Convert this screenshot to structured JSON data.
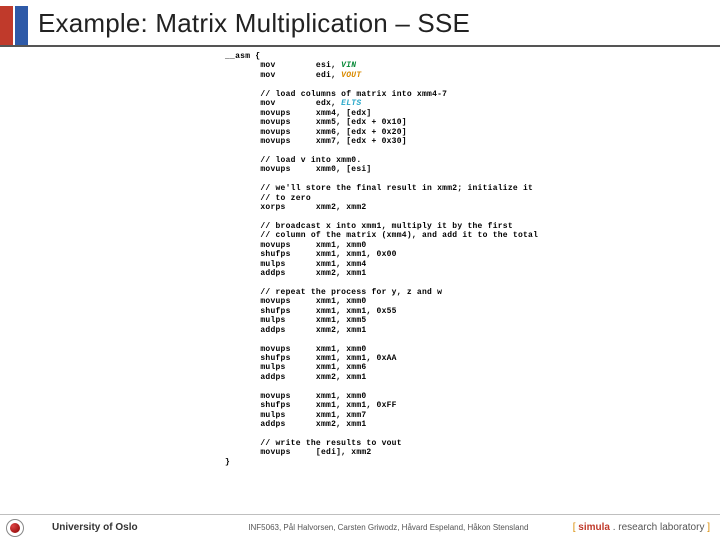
{
  "slide": {
    "title": "Example: Matrix Multiplication – SSE"
  },
  "code": {
    "lines": [
      {
        "t": "__asm {"
      },
      {
        "t": "       mov        esi, ",
        "kw": "VIN",
        "cls": "kw-green"
      },
      {
        "t": "       mov        edi, ",
        "kw": "VOUT",
        "cls": "kw-orange"
      },
      {
        "t": ""
      },
      {
        "t": "       // load columns of matrix into xmm4-7"
      },
      {
        "t": "       mov        edx, ",
        "kw": "ELTS",
        "cls": "kw-cyan"
      },
      {
        "t": "       movups     xmm4, [edx]"
      },
      {
        "t": "       movups     xmm5, [edx + 0x10]"
      },
      {
        "t": "       movups     xmm6, [edx + 0x20]"
      },
      {
        "t": "       movups     xmm7, [edx + 0x30]"
      },
      {
        "t": ""
      },
      {
        "t": "       // load v into xmm0."
      },
      {
        "t": "       movups     xmm0, [esi]"
      },
      {
        "t": ""
      },
      {
        "t": "       // we'll store the final result in xmm2; initialize it"
      },
      {
        "t": "       // to zero"
      },
      {
        "t": "       xorps      xmm2, xmm2"
      },
      {
        "t": ""
      },
      {
        "t": "       // broadcast x into xmm1, multiply it by the first"
      },
      {
        "t": "       // column of the matrix (xmm4), and add it to the total"
      },
      {
        "t": "       movups     xmm1, xmm0"
      },
      {
        "t": "       shufps     xmm1, xmm1, 0x00"
      },
      {
        "t": "       mulps      xmm1, xmm4"
      },
      {
        "t": "       addps      xmm2, xmm1"
      },
      {
        "t": ""
      },
      {
        "t": "       // repeat the process for y, z and w"
      },
      {
        "t": "       movups     xmm1, xmm0"
      },
      {
        "t": "       shufps     xmm1, xmm1, 0x55"
      },
      {
        "t": "       mulps      xmm1, xmm5"
      },
      {
        "t": "       addps      xmm2, xmm1"
      },
      {
        "t": ""
      },
      {
        "t": "       movups     xmm1, xmm0"
      },
      {
        "t": "       shufps     xmm1, xmm1, 0xAA"
      },
      {
        "t": "       mulps      xmm1, xmm6"
      },
      {
        "t": "       addps      xmm2, xmm1"
      },
      {
        "t": ""
      },
      {
        "t": "       movups     xmm1, xmm0"
      },
      {
        "t": "       shufps     xmm1, xmm1, 0xFF"
      },
      {
        "t": "       mulps      xmm1, xmm7"
      },
      {
        "t": "       addps      xmm2, xmm1"
      },
      {
        "t": ""
      },
      {
        "t": "       // write the results to vout"
      },
      {
        "t": "       movups     [edi], xmm2"
      },
      {
        "t": "}"
      }
    ]
  },
  "footer": {
    "left": "University of Oslo",
    "mid": "INF5063, Pål Halvorsen, Carsten Griwodz, Håvard Espeland, Håkon Stensland",
    "right_bracket_open": "[ ",
    "right_brand": "simula",
    "right_rest": " . research laboratory ",
    "right_bracket_close": "]"
  }
}
